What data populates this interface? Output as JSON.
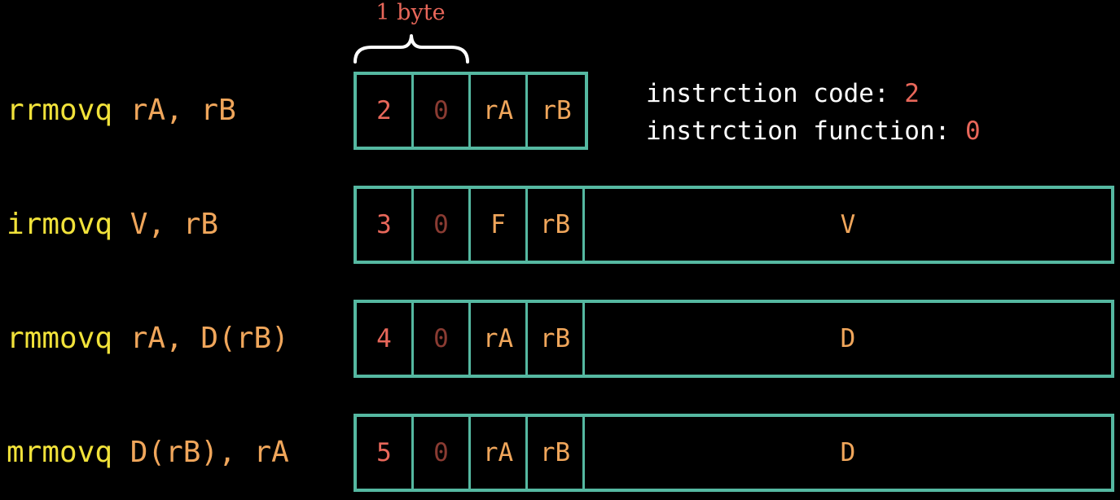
{
  "brace_label": "1 byte",
  "legend": {
    "code_label": "instrction code:",
    "code_value": "2",
    "function_label": "instrction function:",
    "function_value": "0"
  },
  "colors": {
    "background": "#000000",
    "mnemonic": "#f1e23a",
    "operands": "#f0a65b",
    "code": "#e8675a",
    "function": "#8a3b32",
    "box_border": "#55b8a1",
    "legend_text": "#ffffff"
  },
  "rows": [
    {
      "op": "rrmovq",
      "args": "rA, rB",
      "cells": [
        "2",
        "0",
        "rA",
        "rB"
      ]
    },
    {
      "op": "irmovq",
      "args": "V, rB",
      "cells": [
        "3",
        "0",
        "F",
        "rB",
        "V"
      ]
    },
    {
      "op": "rmmovq",
      "args": "rA, D(rB)",
      "cells": [
        "4",
        "0",
        "rA",
        "rB",
        "D"
      ]
    },
    {
      "op": "mrmovq",
      "args": "D(rB), rA",
      "cells": [
        "5",
        "0",
        "rA",
        "rB",
        "D"
      ]
    }
  ]
}
